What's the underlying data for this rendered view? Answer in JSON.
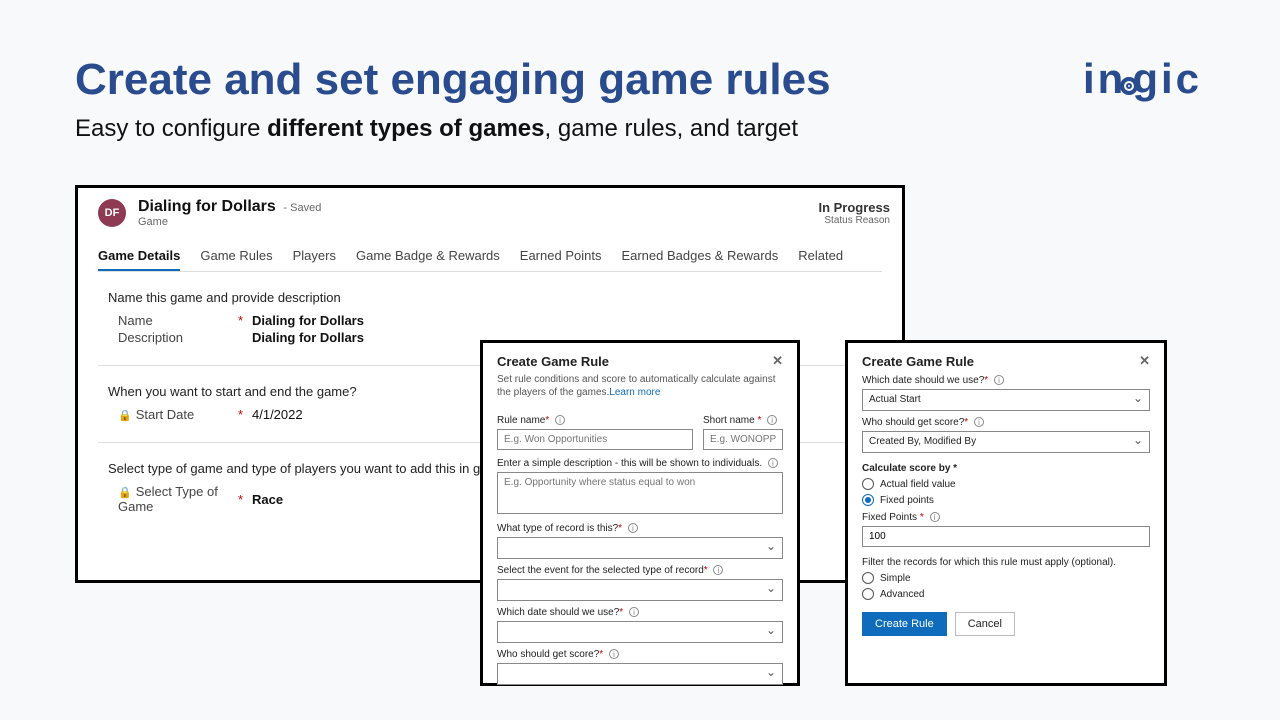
{
  "slide": {
    "title": "Create and set engaging game rules",
    "subtitle_pre": "Easy to configure ",
    "subtitle_bold": "different types of games",
    "subtitle_post": ", game rules, and target"
  },
  "logo": {
    "text_left": "in",
    "text_right": "gic"
  },
  "main": {
    "avatar": "DF",
    "title": "Dialing for Dollars",
    "saved": "- Saved",
    "entity": "Game",
    "status_value": "In Progress",
    "status_label": "Status Reason",
    "tabs": [
      "Game Details",
      "Game Rules",
      "Players",
      "Game Badge & Rewards",
      "Earned Points",
      "Earned Badges & Rewards",
      "Related"
    ],
    "section1": "Name this game and provide description",
    "field_name": {
      "label": "Name",
      "value": "Dialing for Dollars"
    },
    "field_desc": {
      "label": "Description",
      "value": "Dialing for Dollars"
    },
    "section2": "When you want to start and end the game?",
    "field_start": {
      "label": "Start Date",
      "value": "4/1/2022"
    },
    "section3": "Select type of game and type of players you want to add this in game?",
    "field_type": {
      "label": "Select Type of Game",
      "value": "Race"
    }
  },
  "dlg1": {
    "title": "Create Game Rule",
    "desc": "Set rule conditions and score to automatically calculate against the players of the games.",
    "learn": "Learn more",
    "rule_name": {
      "label": "Rule name",
      "placeholder": "E.g. Won Opportunities"
    },
    "short_name": {
      "label": "Short name ",
      "placeholder": "E.g. WONOPP"
    },
    "desc_field": {
      "label": "Enter a simple description - this will be shown to individuals.",
      "placeholder": "E.g. Opportunity where status equal to won"
    },
    "record_type": "What type of record is this?",
    "event": "Select the event for the selected type of record",
    "date": "Which date should we use?",
    "score": "Who should get score?"
  },
  "dlg2": {
    "title": "Create Game Rule",
    "date_label": "Which date should we use?",
    "date_value": "Actual Start",
    "score_label": "Who should get score?",
    "score_value": "Created By, Modified By",
    "calc_label": "Calculate score by ",
    "opt_actual": "Actual field value",
    "opt_fixed": "Fixed points",
    "fixed_label": "Fixed Points ",
    "fixed_value": "100",
    "filter_label": "Filter the records for which this rule must apply (optional).",
    "opt_simple": "Simple",
    "opt_advanced": "Advanced",
    "btn_create": "Create Rule",
    "btn_cancel": "Cancel"
  }
}
